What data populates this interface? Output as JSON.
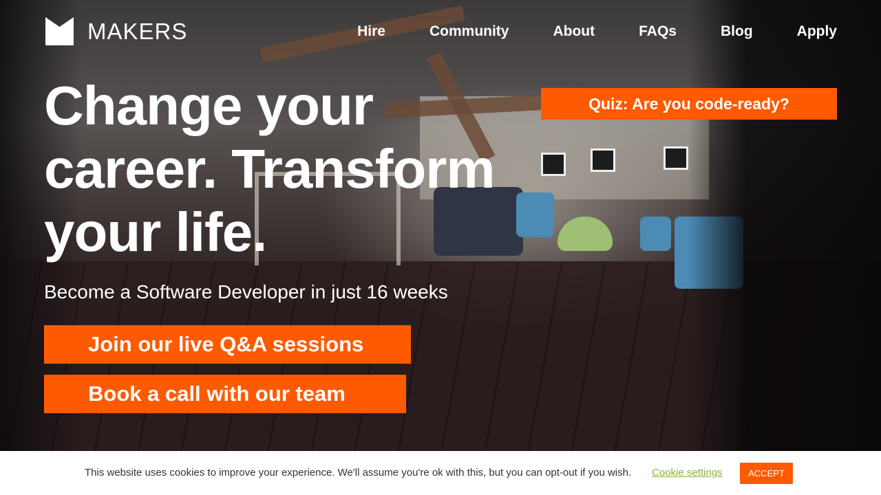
{
  "brand": {
    "name": "MAKERS",
    "logo_icon": "makers-m-logo-icon"
  },
  "nav": {
    "items": [
      {
        "label": "Hire"
      },
      {
        "label": "Community"
      },
      {
        "label": "About"
      },
      {
        "label": "FAQs"
      },
      {
        "label": "Blog"
      },
      {
        "label": "Apply"
      }
    ]
  },
  "quiz": {
    "label": "Quiz: Are you code-ready?"
  },
  "hero": {
    "headline": "Change your career. Transform your life.",
    "subheadline": "Become a Software Developer in just 16 weeks",
    "cta_primary": "Join our live Q&A sessions",
    "cta_secondary": "Book a call with our team"
  },
  "cookie": {
    "message": "This website uses cookies to improve your experience. We'll assume you're ok with this, but you can opt-out if you wish.",
    "settings_label": "Cookie settings",
    "accept_label": "ACCEPT"
  },
  "colors": {
    "accent": "#ff5a00",
    "cookie_link": "#8db13f",
    "text_on_hero": "#ffffff"
  }
}
